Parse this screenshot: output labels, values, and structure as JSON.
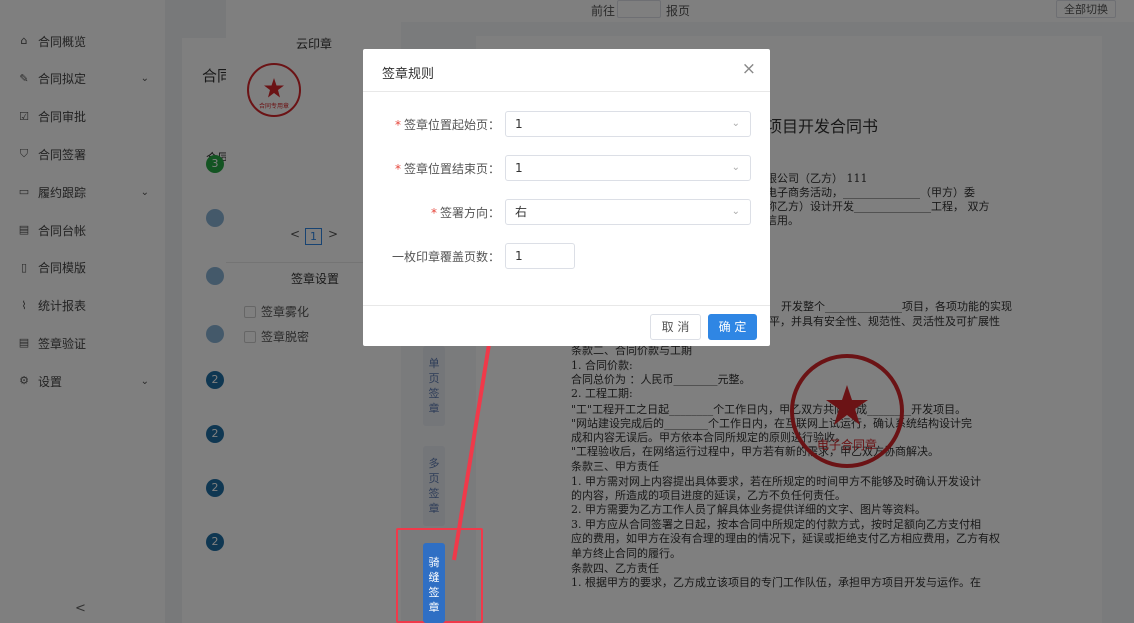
{
  "sidebar": {
    "items": [
      {
        "label": "合同概览",
        "icon": "home-icon",
        "glyph": "⌂",
        "has_children": false
      },
      {
        "label": "合同拟定",
        "icon": "edit-icon",
        "glyph": "✎",
        "has_children": true
      },
      {
        "label": "合同审批",
        "icon": "checkbox-icon",
        "glyph": "☑",
        "has_children": false
      },
      {
        "label": "合同签署",
        "icon": "shield-icon",
        "glyph": "⛉",
        "has_children": false
      },
      {
        "label": "履约跟踪",
        "icon": "track-icon",
        "glyph": "▭",
        "has_children": true
      },
      {
        "label": "合同台帐",
        "icon": "ledger-icon",
        "glyph": "▤",
        "has_children": false
      },
      {
        "label": "合同模版",
        "icon": "template-icon",
        "glyph": "▯",
        "has_children": false
      },
      {
        "label": "统计报表",
        "icon": "chart-icon",
        "glyph": "⌇",
        "has_children": false
      },
      {
        "label": "签章验证",
        "icon": "verify-icon",
        "glyph": "▤",
        "has_children": false
      },
      {
        "label": "设置",
        "icon": "gear-icon",
        "glyph": "⚙",
        "has_children": true
      }
    ],
    "collapse_glyph": "<"
  },
  "page": {
    "title_partial": "合同",
    "column_partial": "合同",
    "badges": [
      "3",
      "",
      "",
      "",
      "2",
      "2",
      "2",
      "2"
    ]
  },
  "drawer": {
    "top_bar": {
      "label_left": "前往",
      "page_value": "",
      "label_right": "报页",
      "button": "全部切换"
    },
    "seal_panel": {
      "title": "云印章",
      "seal_text": "合同专用章",
      "pager": {
        "prev": "<",
        "current": "1",
        "next": ">"
      },
      "settings_title": "签章设置",
      "options": [
        {
          "label": "签章雾化",
          "checked": false
        },
        {
          "label": "签章脱密",
          "checked": false
        }
      ]
    },
    "side_buttons": [
      {
        "label": "单页签章",
        "active": false
      },
      {
        "label": "多页签章",
        "active": false
      },
      {
        "label": "骑缝签章",
        "active": true
      }
    ],
    "document": {
      "title": "项目开发合同书",
      "seal_text": "电子合同章",
      "lines": [
        "）",
        "限公司（乙方）    111",
        "电子商务活动，______________（甲方）委",
        "称乙方）设计开发______________工程，  双方",
        "信用。",
        "计、技术培训与支持。",
        "开发整个______________项目，各项功能的实现",
        "程度和性能指标应该达到现阶段的先进水平，并具有安全性、规范性、灵活性及可扩展性",
        "条款二、合同价款与工期",
        "    1. 合同价款:",
        "    合同总价为  ：人民币________元整。",
        "    2. 工程工期:",
        "    \"工\"工程开工之日起________个工作日内，甲乙双方共同完成________开发项目。",
        "    \"网站建设完成后的________个工作日内，在互联网上试运行，确认系统结构设计完",
        "成和内容无误后。甲方依本合同所规定的原则进行验收。",
        "    \"工程验收后，在网络运行过程中，甲方若有新的需求，甲乙双方协商解决。",
        "条款三、甲方责任",
        "    1. 甲方需对网上内容提出具体要求，若在所规定的时间甲方不能够及时确认开发设计",
        "的内容，所造成的项目进度的延误，乙方不负任何责任。",
        "    2. 甲方需要为乙方工作人员了解具体业务提供详细的文字、图片等资料。",
        "    3. 甲方应从合同签署之日起，按本合同中所规定的付款方式，按时足额向乙方支付相",
        "应的费用，如甲方在没有合理的理由的情况下，延误或拒绝支付乙方相应费用，乙方有权",
        "单方终止合同的履行。",
        "条款四、乙方责任",
        "    1. 根据甲方的要求，乙方成立该项目的专门工作队伍，承担甲方项目开发与运作。在"
      ]
    }
  },
  "dialog": {
    "title": "签章规则",
    "close_glyph": "×",
    "fields": [
      {
        "label": "签章位置起始页：",
        "required": true,
        "type": "select",
        "value": "1"
      },
      {
        "label": "签章位置结束页：",
        "required": true,
        "type": "select",
        "value": "1"
      },
      {
        "label": "签署方向：",
        "required": true,
        "type": "select",
        "value": "右"
      },
      {
        "label": "一枚印章覆盖页数：",
        "required": false,
        "type": "input",
        "value": "1"
      }
    ],
    "cancel_label": "取 消",
    "confirm_label": "确 定"
  },
  "colors": {
    "primary": "#2f86e4",
    "required": "#e6453a",
    "annotation": "#f0394a",
    "seal_red": "#d7262b"
  }
}
